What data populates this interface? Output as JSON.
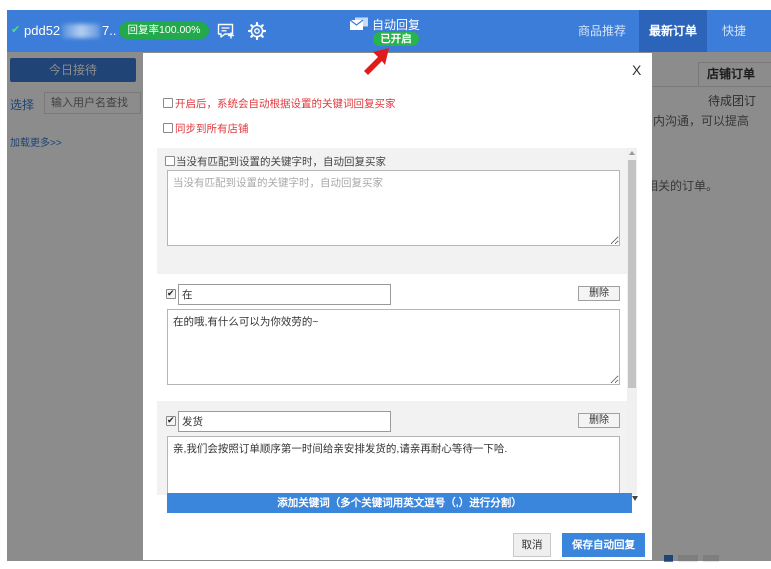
{
  "colors": {
    "topbar": "#3b7dd8",
    "active_tab": "#2c64ba",
    "success": "#22a94b",
    "danger": "#e0393e",
    "primary_button": "#3a86dc"
  },
  "topbar": {
    "status_icon": "check-icon",
    "account_name": "pdd52",
    "account_suffix": "7..",
    "reply_rate": "回复率100.00%",
    "icons": [
      "chat-add-icon",
      "gear-icon"
    ],
    "auto_reply": {
      "icon": "mail-reply-icon",
      "label": "自动回复",
      "status": "已开启"
    },
    "tabs": [
      {
        "label": "商品推荐",
        "active": false
      },
      {
        "label": "最新订单",
        "active": true
      },
      {
        "label": "快捷",
        "active": false
      }
    ]
  },
  "sidebar": {
    "today_button": "今日接待",
    "select_label": "选择",
    "search_placeholder": "输入用户名查找",
    "load_more": "加载更多>>"
  },
  "order_panel": {
    "tab": "店铺订单",
    "lines": [
      "待成团订",
      "内沟通，可以提高",
      "相关的订单。"
    ]
  },
  "modal": {
    "close": "X",
    "options": [
      {
        "label": "开启后，系统会自动根据设置的关键词回复买家",
        "checked": false
      },
      {
        "label": "同步到所有店铺",
        "checked": false
      }
    ],
    "default_reply": {
      "label": "当没有匹配到设置的关键字时，自动回复买家",
      "checked": false,
      "placeholder": "当没有匹配到设置的关键字时，自动回复买家"
    },
    "keywords": [
      {
        "keyword": "在",
        "checked": true,
        "reply": "在的哦,有什么可以为你效劳的~",
        "delete_label": "删除"
      },
      {
        "keyword": "发货",
        "checked": true,
        "reply": "亲,我们会按照订单顺序第一时间给亲安排发货的,请亲再耐心等待一下哈.",
        "delete_label": "删除"
      }
    ],
    "add_keyword_bar": "添加关键词（多个关键词用英文逗号（,）进行分割）",
    "cancel": "取消",
    "save": "保存自动回复"
  }
}
